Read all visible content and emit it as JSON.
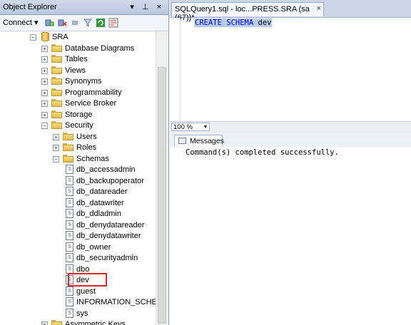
{
  "object_explorer": {
    "title": "Object Explorer",
    "title_buttons": "▾ ⊥ ×",
    "connect_label": "Connect ▾",
    "tree": [
      {
        "label": "SRA",
        "kind": "database",
        "expander": "−"
      },
      {
        "label": "Database Diagrams",
        "kind": "folder",
        "expander": "+"
      },
      {
        "label": "Tables",
        "kind": "folder",
        "expander": "+"
      },
      {
        "label": "Views",
        "kind": "folder",
        "expander": "+"
      },
      {
        "label": "Synonyms",
        "kind": "folder",
        "expander": "+"
      },
      {
        "label": "Programmability",
        "kind": "folder",
        "expander": "+"
      },
      {
        "label": "Service Broker",
        "kind": "folder",
        "expander": "+"
      },
      {
        "label": "Storage",
        "kind": "folder",
        "expander": "+"
      },
      {
        "label": "Security",
        "kind": "folder",
        "expander": "−"
      },
      {
        "label": "Users",
        "kind": "folder",
        "expander": "+"
      },
      {
        "label": "Roles",
        "kind": "folder",
        "expander": "+"
      },
      {
        "label": "Schemas",
        "kind": "folder",
        "expander": "−"
      },
      {
        "label": "db_accessadmin",
        "kind": "schema"
      },
      {
        "label": "db_backupoperator",
        "kind": "schema"
      },
      {
        "label": "db_datareader",
        "kind": "schema"
      },
      {
        "label": "db_datawriter",
        "kind": "schema"
      },
      {
        "label": "db_ddladmin",
        "kind": "schema"
      },
      {
        "label": "db_denydatareader",
        "kind": "schema"
      },
      {
        "label": "db_denydatawriter",
        "kind": "schema"
      },
      {
        "label": "db_owner",
        "kind": "schema"
      },
      {
        "label": "db_securityadmin",
        "kind": "schema"
      },
      {
        "label": "dbo",
        "kind": "schema"
      },
      {
        "label": "dev",
        "kind": "schema"
      },
      {
        "label": "guest",
        "kind": "schema"
      },
      {
        "label": "INFORMATION_SCHE",
        "kind": "schema"
      },
      {
        "label": "sys",
        "kind": "schema"
      },
      {
        "label": "Asymmetric Keys",
        "kind": "folder",
        "expander": "+"
      }
    ]
  },
  "editor": {
    "tab_title": "SQLQuery1.sql - loc...PRESS.SRA (sa (67))*",
    "tab_close": "×",
    "code_keyword": "CREATE SCHEMA",
    "code_identifier": "dev",
    "zoom_value": "100 %",
    "results_tab_label": "Messages",
    "message": "Command(s) completed successfully."
  },
  "colors": {
    "highlight_box": "#e2262b",
    "keyword": "#0000ff",
    "selection": "#b7cdf0"
  }
}
